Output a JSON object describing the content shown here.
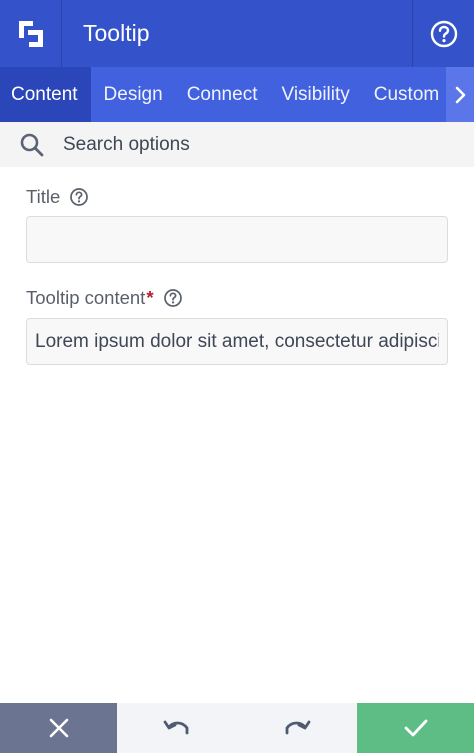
{
  "header": {
    "title": "Tooltip",
    "logo_icon": "builder-logo-icon",
    "help_icon": "help-circle-icon"
  },
  "tabs": [
    {
      "label": "Content",
      "active": true
    },
    {
      "label": "Design",
      "active": false
    },
    {
      "label": "Connect",
      "active": false
    },
    {
      "label": "Visibility",
      "active": false
    },
    {
      "label": "Custom",
      "active": false
    }
  ],
  "search": {
    "placeholder": "Search options",
    "icon": "search-icon"
  },
  "fields": {
    "title": {
      "label": "Title",
      "value": ""
    },
    "tooltip_content": {
      "label": "Tooltip content",
      "required_mark": "*",
      "value": "Lorem ipsum dolor sit amet, consectetur adipiscing elit."
    }
  },
  "footer": {
    "cancel_icon": "close-icon",
    "undo_icon": "undo-icon",
    "redo_icon": "redo-icon",
    "confirm_icon": "check-icon"
  },
  "colors": {
    "header_bg": "#3453ca",
    "tabs_bg": "#4161de",
    "active_tab_bg": "#2a46b8",
    "cancel_bg": "#6b7491",
    "confirm_bg": "#5dbd85"
  }
}
